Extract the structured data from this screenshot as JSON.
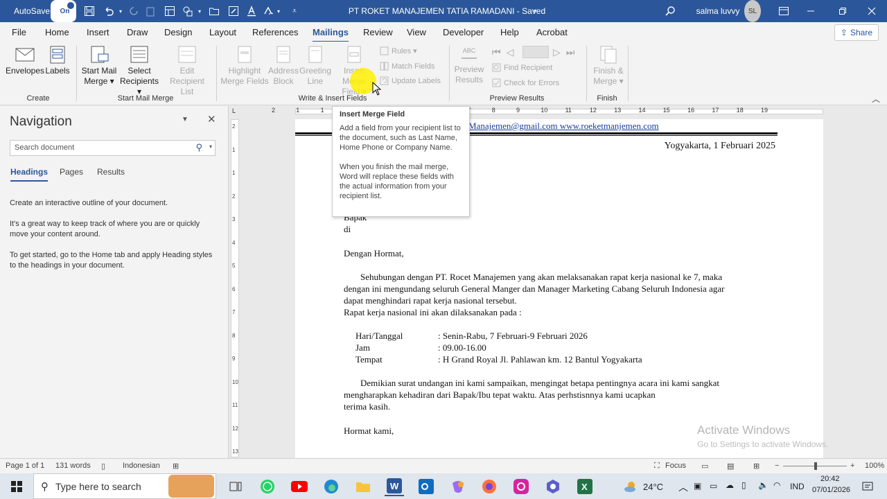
{
  "titlebar": {
    "autosave_label": "AutoSave",
    "autosave_state": "On",
    "doc_title": "PT ROKET MANAJEMEN TATIA RAMADANI  -  Saved",
    "user_name": "salma luvvy",
    "user_initials": "SL"
  },
  "tabs": [
    "File",
    "Home",
    "Insert",
    "Draw",
    "Design",
    "Layout",
    "References",
    "Mailings",
    "Review",
    "View",
    "Developer",
    "Help",
    "Acrobat"
  ],
  "active_tab": "Mailings",
  "share_label": "Share",
  "ribbon": {
    "create": {
      "label": "Create",
      "envelopes": "Envelopes",
      "labels": "Labels"
    },
    "start": {
      "label": "Start Mail Merge",
      "start_mail_merge_1": "Start Mail",
      "start_mail_merge_2": "Merge",
      "select_recipients_1": "Select",
      "select_recipients_2": "Recipients",
      "edit_list_1": "Edit",
      "edit_list_2": "Recipient List"
    },
    "write": {
      "label": "Write & Insert Fields",
      "highlight_1": "Highlight",
      "highlight_2": "Merge Fields",
      "address_1": "Address",
      "address_2": "Block",
      "greeting_1": "Greeting",
      "greeting_2": "Line",
      "insert_1": "Insert Merge",
      "insert_2": "Field",
      "rules": "Rules",
      "match_fields": "Match Fields",
      "update_labels": "Update Labels"
    },
    "preview": {
      "label": "Preview Results",
      "abc": "ABC",
      "preview_1": "Preview",
      "preview_2": "Results",
      "find_recipient": "Find Recipient",
      "check_errors": "Check for Errors"
    },
    "finish": {
      "label": "Finish",
      "finish_1": "Finish &",
      "finish_2": "Merge"
    }
  },
  "tooltip": {
    "title": "Insert Merge Field",
    "body1": "Add a field from your recipient list to the document, such as Last Name, Home Phone or Company Name.",
    "body2": "When you finish the mail merge, Word will replace these fields with the actual information from your recipient list."
  },
  "navigation": {
    "title": "Navigation",
    "search_placeholder": "Search document",
    "tabs": [
      "Headings",
      "Pages",
      "Results"
    ],
    "p1": "Create an interactive outline of your document.",
    "p2": "It's a great way to keep track of where you are or quickly move your content around.",
    "p3": "To get started, go to the Home tab and apply Heading styles to the headings in your document."
  },
  "document": {
    "email": "Manajemen@gmail.com",
    "website": "www.roeketmanjemen.com",
    "date": "Yogyakarta, 1 Februari 2025",
    "bapak": "Bapak",
    "di": "di",
    "salutation": "Dengan Hormat,",
    "para1_l1": "Sehubungan dengan PT. Rocet Manajemen yang akan melaksanakan rapat kerja nasional ke 7, maka",
    "para1_l2": "dengan ini mengundang seluruh General Manger dan Manager Marketing Cabang Seluruh Indonesia agar",
    "para1_l3": "dapat menghindari rapat kerja nasional tersebut.",
    "para2": "Rapat kerja nasional ini akan dilaksanakan pada :",
    "details": [
      {
        "label": "Hari/Tanggal",
        "value": ": Senin-Rabu, 7 Februari-9 Februari 2026"
      },
      {
        "label": "Jam",
        "value": ": 09.00-16.00"
      },
      {
        "label": "Tempat",
        "value": ": H Grand Royal Jl. Pahlawan km. 12 Bantul Yogyakarta"
      }
    ],
    "para3_l1": "Demikian surat undangan ini kami sampaikan, mengingat betapa pentingnya acara ini kami sangkat",
    "para3_l2": "mengharapkan kehadiran dari Bapak/Ibu tepat waktu. Atas perhstisnnya kami ucapkan",
    "para3_l3": "terima kasih.",
    "closing": "Hormat kami,"
  },
  "ruler_numbers": [
    "2",
    "1",
    "1",
    "2",
    "3",
    "4",
    "5",
    "6",
    "7",
    "8",
    "9",
    "10",
    "11",
    "12",
    "13",
    "14",
    "15",
    "16",
    "17",
    "18",
    "19"
  ],
  "vruler_numbers": [
    "2",
    "1",
    "1",
    "2",
    "3",
    "4",
    "5",
    "6",
    "7",
    "8",
    "9",
    "10",
    "11",
    "12",
    "13",
    "14",
    "15"
  ],
  "watermark": {
    "line1": "Activate Windows",
    "line2": "Go to Settings to activate Windows."
  },
  "statusbar": {
    "page": "Page 1 of 1",
    "words": "131 words",
    "language": "Indonesian",
    "focus": "Focus",
    "zoom": "100%"
  },
  "taskbar": {
    "search_placeholder": "Type here to search",
    "weather": "24°C",
    "lang": "IND",
    "time": "20:42",
    "date": "07/01/2026"
  },
  "colors": {
    "word_blue": "#2b579a",
    "highlight": "#fff000"
  }
}
